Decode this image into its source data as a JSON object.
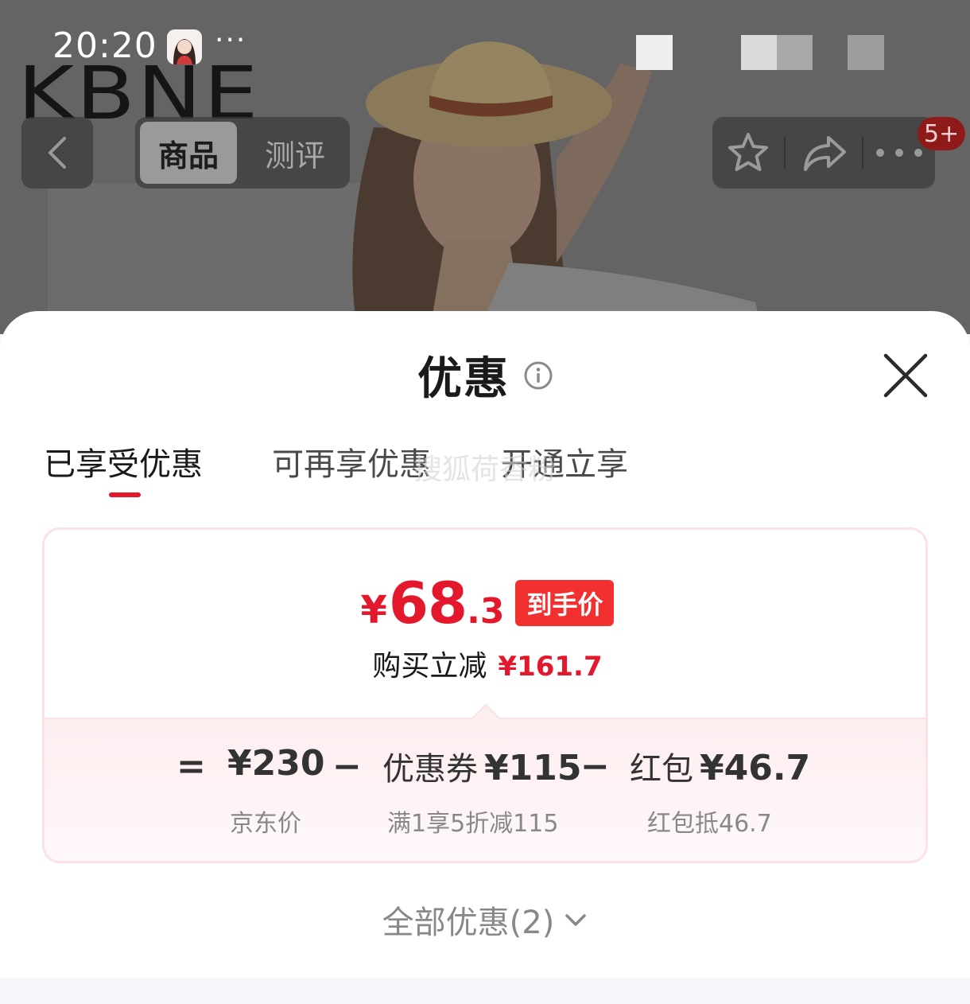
{
  "status_bar": {
    "time": "20:20",
    "more": "···"
  },
  "header": {
    "brand": "KBNE",
    "tabs": [
      {
        "label": "商品",
        "active": true
      },
      {
        "label": "测评",
        "active": false
      }
    ],
    "badge": "5+"
  },
  "sheet": {
    "title": "优惠",
    "tabs": [
      {
        "label": "已享受优惠",
        "active": true
      },
      {
        "label": "可再享优惠",
        "active": false
      },
      {
        "label": "开通立享",
        "active": false
      }
    ],
    "watermark": "搜狐荷香粉",
    "deal": {
      "final_price_symbol": "¥",
      "final_price_int": "68",
      "final_price_dec": ".3",
      "final_tag": "到手价",
      "save_label": "购买立减",
      "save_amount": "¥161.7",
      "breakdown": {
        "eq": "=",
        "minus": "−",
        "base_price": "¥230",
        "base_label": "京东价",
        "coupon_label": "优惠券",
        "coupon_value": "¥115",
        "coupon_desc": "满1享5折减115",
        "redpacket_label": "红包",
        "redpacket_value": "¥46.7",
        "redpacket_desc": "红包抵46.7"
      }
    },
    "all_deals": "全部优惠(2)"
  },
  "colors": {
    "accent": "#e3182c",
    "tag_bg": "#f23030",
    "card_border": "#fce1e6",
    "breakdown_bg": "#fdeef0"
  }
}
